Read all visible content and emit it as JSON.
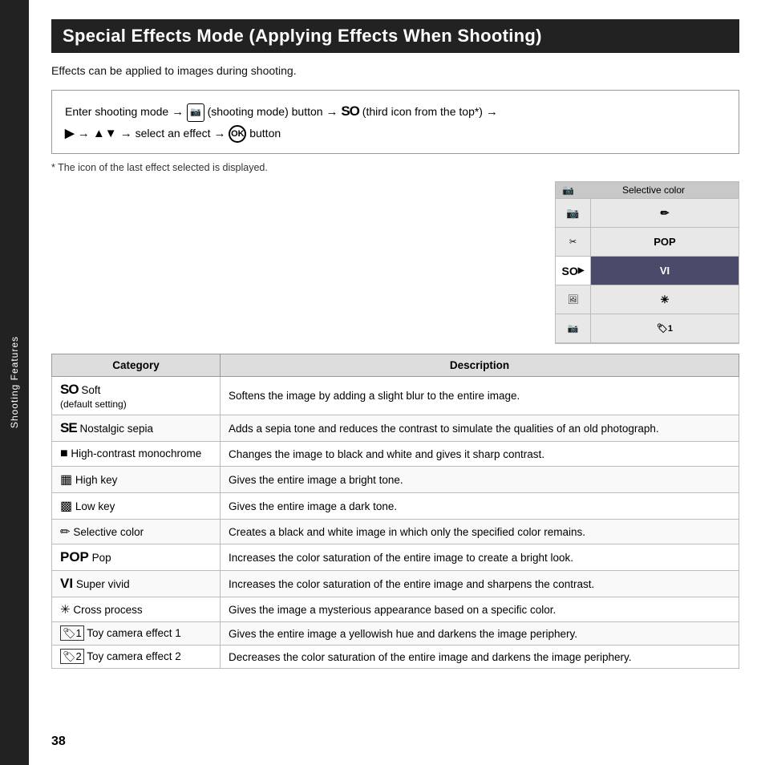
{
  "page": {
    "title": "Special Effects Mode (Applying Effects When Shooting)",
    "subtitle": "Effects can be applied to images during shooting.",
    "instruction": {
      "line1_prefix": "Enter shooting mode → ",
      "line1_camera": "📷",
      "line1_middle": " (shooting mode) button → ",
      "line1_so": "SO",
      "line1_suffix": " (third icon from the top*) →",
      "line2": "▶ → ▲▼ → select an effect → ",
      "line2_ok": "OK",
      "line2_suffix": " button"
    },
    "footnote": "*  The icon of the last effect selected is displayed.",
    "camera_ui": {
      "header_label": "Selective color",
      "rows_left": [
        "📷",
        "✏",
        "SO",
        "🖼",
        "📷"
      ],
      "rows_right": [
        "✏",
        "POP",
        "VI",
        "✱",
        "🏷1"
      ]
    },
    "table": {
      "col_category": "Category",
      "col_description": "Description",
      "rows": [
        {
          "icon": "SO",
          "icon_type": "so",
          "name": "Soft",
          "name_extra": "(default setting)",
          "description": "Softens the image by adding a slight blur to the entire image."
        },
        {
          "icon": "SE",
          "icon_type": "se",
          "name": "Nostalgic sepia",
          "name_extra": "",
          "description": "Adds a sepia tone and reduces the contrast to simulate the qualities of an old photograph."
        },
        {
          "icon": "■",
          "icon_type": "square",
          "name": "High-contrast monochrome",
          "name_extra": "",
          "description": "Changes the image to black and white and gives it sharp contrast."
        },
        {
          "icon": "▦",
          "icon_type": "grid",
          "name": "High key",
          "name_extra": "",
          "description": "Gives the entire image a bright tone."
        },
        {
          "icon": "▩",
          "icon_type": "grid2",
          "name": "Low key",
          "name_extra": "",
          "description": "Gives the entire image a dark tone."
        },
        {
          "icon": "✏",
          "icon_type": "pencil",
          "name": "Selective color",
          "name_extra": "",
          "description": "Creates a black and white image in which only the specified color remains."
        },
        {
          "icon": "POP",
          "icon_type": "pop",
          "name": "Pop",
          "name_extra": "",
          "description": "Increases the color saturation of the entire image to create a bright look."
        },
        {
          "icon": "VI",
          "icon_type": "vi",
          "name": "Super vivid",
          "name_extra": "",
          "description": "Increases the color saturation of the entire image and sharpens the contrast."
        },
        {
          "icon": "✳",
          "icon_type": "cross",
          "name": "Cross process",
          "name_extra": "",
          "description": "Gives the image a mysterious appearance based on a specific color."
        },
        {
          "icon": "🏷1",
          "icon_type": "toy1",
          "name": "Toy camera effect 1",
          "name_extra": "",
          "description": "Gives the entire image a yellowish hue and darkens the image periphery."
        },
        {
          "icon": "🏷2",
          "icon_type": "toy2",
          "name": "Toy camera effect 2",
          "name_extra": "",
          "description": "Decreases the color saturation of the entire image and darkens the image periphery."
        }
      ]
    },
    "page_number": "38",
    "sidebar_label": "Shooting Features"
  }
}
